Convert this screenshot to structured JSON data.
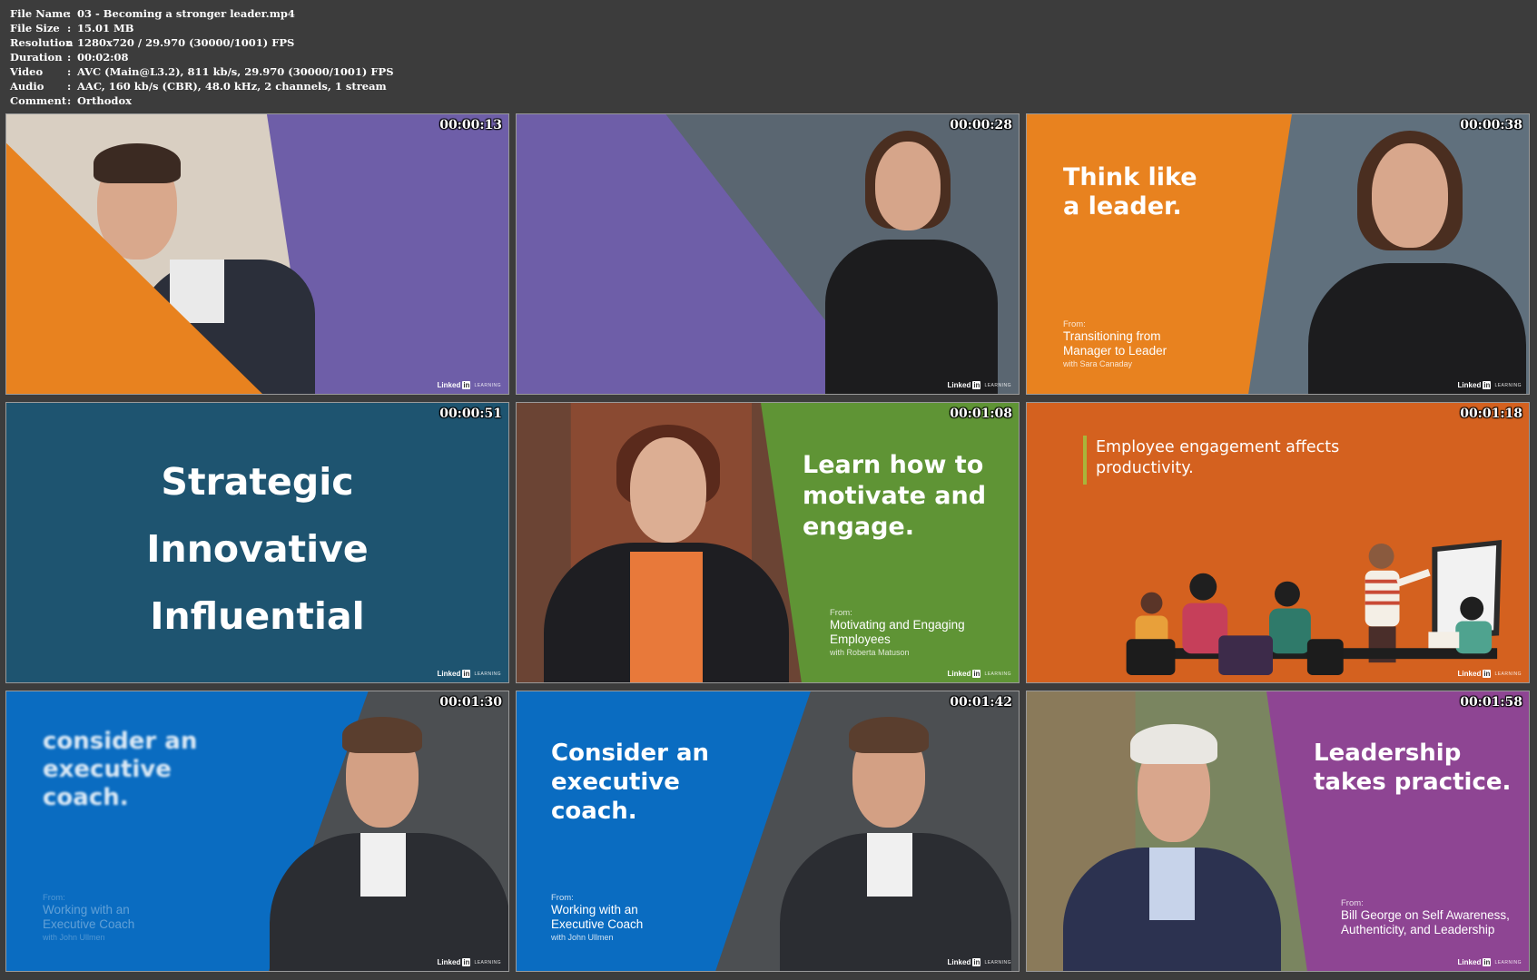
{
  "metadata": [
    {
      "key": "File Name",
      "value": "03 - Becoming a stronger leader.mp4"
    },
    {
      "key": "File Size",
      "value": "15.01 MB"
    },
    {
      "key": "Resolution",
      "value": "1280x720 / 29.970 (30000/1001) FPS"
    },
    {
      "key": "Duration",
      "value": "00:02:08"
    },
    {
      "key": "Video",
      "value": "AVC (Main@L3.2), 811 kb/s, 29.970 (30000/1001) FPS"
    },
    {
      "key": "Audio",
      "value": "AAC, 160 kb/s (CBR), 48.0 kHz, 2 channels, 1 stream"
    },
    {
      "key": "Comment",
      "value": "Orthodox"
    }
  ],
  "separator": ":",
  "logo": {
    "brand": "Linked",
    "in": "in",
    "suffix": "LEARNING"
  },
  "colors": {
    "orange": "#e8821f",
    "purple": "#6e5ea8",
    "teal": "#1e5470",
    "green": "#5f9435",
    "rust": "#d4611f",
    "blue": "#0a6cc1",
    "magenta": "#8e4593"
  },
  "thumbs": [
    {
      "timestamp": "00:00:13"
    },
    {
      "timestamp": "00:00:28"
    },
    {
      "timestamp": "00:00:38",
      "title": [
        "Think like",
        "a leader."
      ],
      "from_label": "From:",
      "course": [
        "Transitioning from",
        "Manager to Leader"
      ],
      "with": "with Sara Canaday"
    },
    {
      "timestamp": "00:00:51",
      "words": [
        "Strategic",
        "Innovative",
        "Influential"
      ]
    },
    {
      "timestamp": "00:01:08",
      "title": [
        "Learn how to",
        "motivate and",
        "engage."
      ],
      "from_label": "From:",
      "course": [
        "Motivating and Engaging",
        "Employees"
      ],
      "with": "with Roberta Matuson"
    },
    {
      "timestamp": "00:01:18",
      "title": [
        "Employee engagement affects",
        "productivity."
      ]
    },
    {
      "timestamp": "00:01:30",
      "title": [
        "consider an",
        "executive",
        "coach."
      ],
      "from_label": "From:",
      "course": [
        "Working with an",
        "Executive Coach"
      ],
      "with": "with John Ullmen"
    },
    {
      "timestamp": "00:01:42",
      "title": [
        "Consider an",
        "executive",
        "coach."
      ],
      "from_label": "From:",
      "course": [
        "Working with an",
        "Executive Coach"
      ],
      "with": "with John Ullmen"
    },
    {
      "timestamp": "00:01:58",
      "title": [
        "Leadership",
        "takes practice."
      ],
      "from_label": "From:",
      "course": [
        "Bill George on Self Awareness,",
        "Authenticity, and Leadership"
      ]
    }
  ]
}
